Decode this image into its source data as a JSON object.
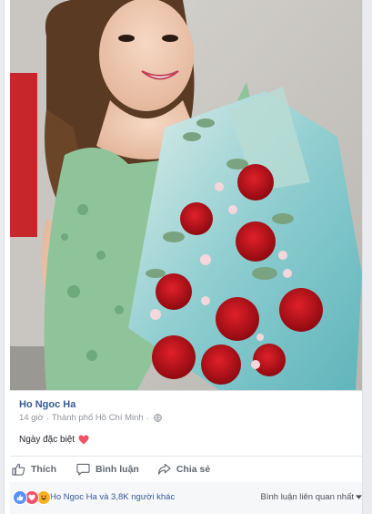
{
  "post": {
    "author": "Ho Ngoc Ha",
    "time": "14 giờ",
    "separator": "·",
    "location": "Thành phố Hồ Chí Minh",
    "text": "Ngày đặc biệt",
    "photo_alt": "Woman in green dress holding bouquet of red roses"
  },
  "actions": {
    "like_label": "Thích",
    "comment_label": "Bình luận",
    "share_label": "Chia sẻ"
  },
  "reactions": {
    "summary": "Ho Ngoc Ha và 3,8K người khác",
    "sort_label": "Bình luận liên quan nhất",
    "icons": [
      "like-icon",
      "love-icon",
      "haha-icon"
    ]
  },
  "colors": {
    "link": "#365899",
    "meta": "#90949c",
    "heart": "#f25268",
    "like_blue": "#5890ff"
  }
}
